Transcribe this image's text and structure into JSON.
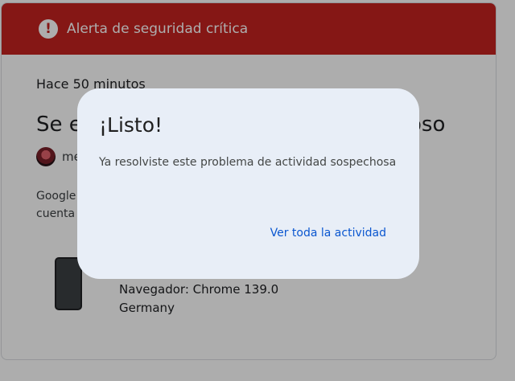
{
  "alert_banner": {
    "title": "Alerta de seguridad crítica",
    "icon": "exclamation-icon",
    "color": "#c5221f"
  },
  "alert_card": {
    "time_ago": "Hace 50 minutos",
    "title_start": "Se e",
    "title_end": "oso",
    "account_partial": "me",
    "body_line_1": "Google",
    "body_line_2": "cuenta",
    "device": {
      "icon": "phone-icon",
      "browser": "Navegador: Chrome 139.0",
      "location": "Germany"
    }
  },
  "dialog": {
    "title": "¡Listo!",
    "body": "Ya resolviste este problema de actividad sospechosa",
    "action_label": "Ver toda la actividad",
    "background": "#e8eef7",
    "action_color": "#0b57d0"
  }
}
